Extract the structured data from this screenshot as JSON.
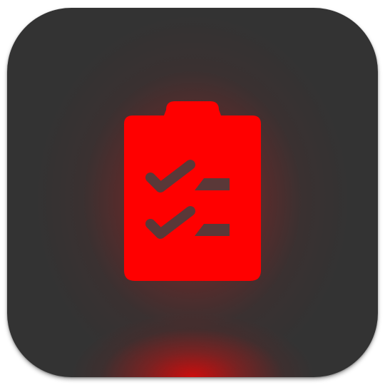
{
  "app_icon": {
    "icon": "clipboard-checklist-icon",
    "colors": {
      "tile_background": "#333333",
      "icon_fill": "#ff0000",
      "icon_cutout": "#5a3838",
      "glow": "#ff0000"
    }
  }
}
